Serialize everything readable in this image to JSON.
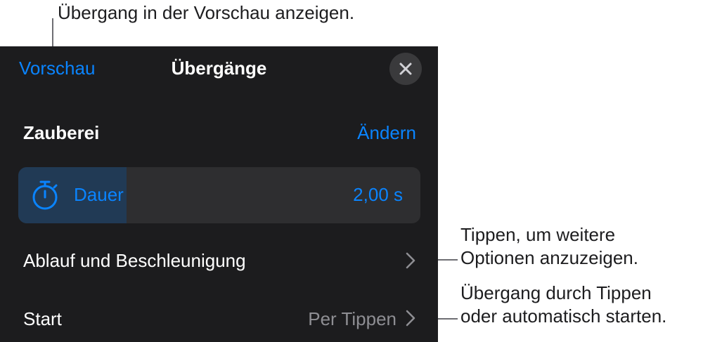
{
  "callouts": {
    "preview": "Übergang in der Vorschau anzeigen.",
    "options": "Tippen, um weitere\nOptionen anzuzeigen.",
    "start": "Übergang durch Tippen\noder automatisch starten."
  },
  "panel": {
    "preview_label": "Vorschau",
    "title": "Übergänge",
    "close_icon": "close-icon",
    "transition_name": "Zauberei",
    "change_label": "Ändern",
    "duration": {
      "icon": "stopwatch-icon",
      "label": "Dauer",
      "value": "2,00 s",
      "slider_fraction": 0.27
    },
    "options_row": {
      "label": "Ablauf und Beschleunigung",
      "icon": "chevron-right-icon"
    },
    "start_row": {
      "label": "Start",
      "value": "Per Tippen",
      "icon": "chevron-right-icon"
    }
  },
  "colors": {
    "accent": "#0a84ff",
    "panel_bg": "#1c1c1e",
    "slider_fill": "#213a55",
    "slider_track": "#2e2e30"
  }
}
